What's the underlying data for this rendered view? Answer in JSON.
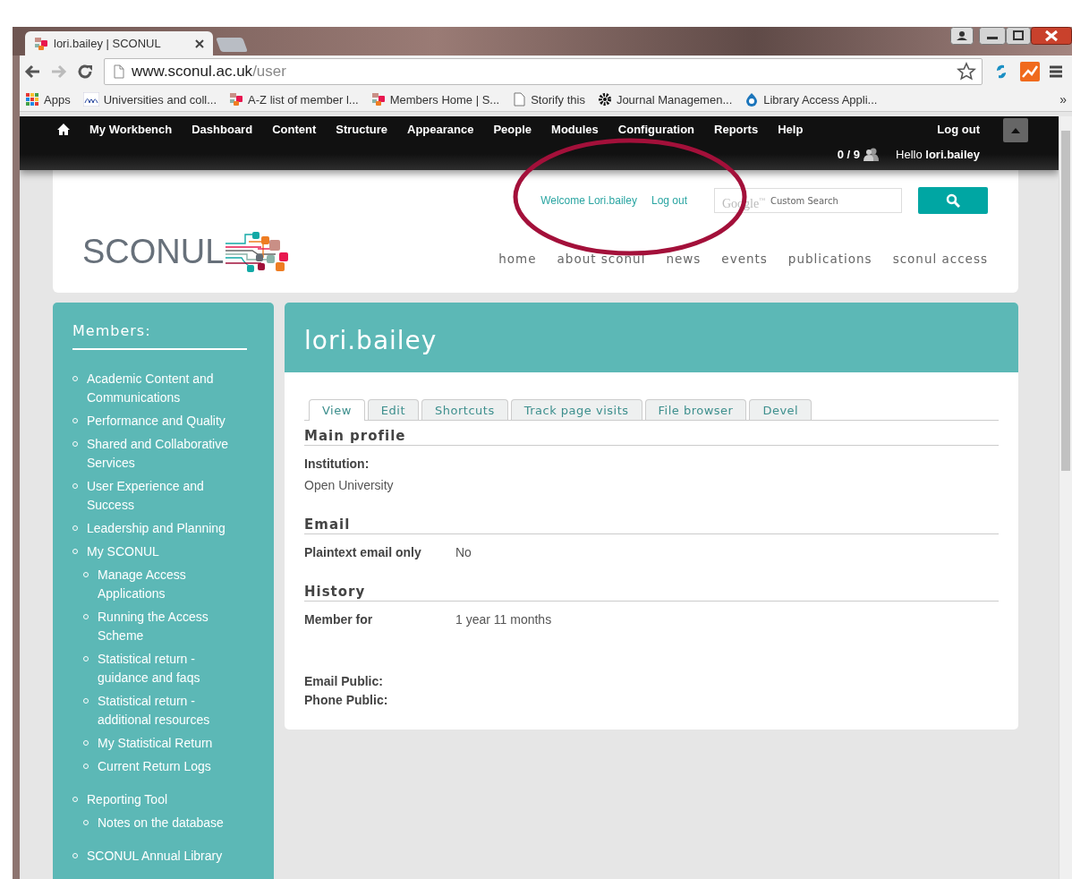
{
  "browser": {
    "tabs": [
      {
        "title": "lori.bailey | SCONUL",
        "kind": "page",
        "selected": true
      },
      {
        "kind": "new",
        "selected": false
      }
    ],
    "url": {
      "host": "www.sconul.ac.uk",
      "path": "/user"
    },
    "bookmarks": [
      {
        "label": "Apps",
        "kind": "apps"
      },
      {
        "label": "Universities and coll...",
        "kind": "hefce"
      },
      {
        "label": "A-Z list of member l...",
        "kind": "sconul"
      },
      {
        "label": "Members Home | S...",
        "kind": "sconul"
      },
      {
        "label": "Storify this",
        "kind": "page"
      },
      {
        "label": "Journal Managemen...",
        "kind": "gear"
      },
      {
        "label": "Library Access Appli...",
        "kind": "drop"
      }
    ],
    "more": "»"
  },
  "admin_bar": {
    "items": [
      "My Workbench",
      "Dashboard",
      "Content",
      "Structure",
      "Appearance",
      "People",
      "Modules",
      "Configuration",
      "Reports",
      "Help"
    ],
    "logout": "Log out",
    "counter": "0 / 9",
    "greeting": "Hello **lori.bailey**"
  },
  "header": {
    "welcome": "Welcome Lori.bailey",
    "logout": "Log out",
    "search": {
      "brand": "Google",
      "brand_mark": "™",
      "placeholder": "Custom Search"
    },
    "logo": "SCONUL",
    "nav": [
      "home",
      "about sconul",
      "news",
      "events",
      "publications",
      "sconul access"
    ]
  },
  "sidebar": {
    "title": "Members:",
    "items": [
      {
        "label": "Academic Content and Communications"
      },
      {
        "label": "Performance and Quality"
      },
      {
        "label": "Shared and Collaborative Services"
      },
      {
        "label": "User Experience and Success"
      },
      {
        "label": "Leadership and Planning"
      },
      {
        "label": "My SCONUL",
        "children": [
          {
            "label": "Manage Access Applications"
          },
          {
            "label": "Running the Access Scheme"
          },
          {
            "label": "Statistical return - guidance and faqs"
          },
          {
            "label": "Statistical return - additional resources"
          },
          {
            "label": "My Statistical Return"
          },
          {
            "label": "Current Return Logs"
          }
        ]
      },
      {
        "label": "Reporting Tool",
        "children": [
          {
            "label": "Notes on the database"
          }
        ]
      },
      {
        "label": "SCONUL Annual Library"
      }
    ]
  },
  "main": {
    "title": "lori.bailey",
    "tabs": [
      {
        "label": "View",
        "selected": true
      },
      {
        "label": "Edit",
        "selected": false
      },
      {
        "label": "Shortcuts",
        "selected": false
      },
      {
        "label": "Track page visits",
        "selected": false
      },
      {
        "label": "File browser",
        "selected": false
      },
      {
        "label": "Devel",
        "selected": false
      }
    ],
    "sections": [
      {
        "heading": "Main profile",
        "fields": [
          {
            "kind": "stacked",
            "label": "Institution:",
            "value": "Open University"
          }
        ]
      },
      {
        "heading": "Email",
        "fields": [
          {
            "kind": "inline",
            "label": "Plaintext email only",
            "value": "No"
          }
        ]
      },
      {
        "heading": "History",
        "fields": [
          {
            "kind": "inline",
            "label": "Member for",
            "value": "1 year 11 months"
          }
        ]
      },
      {
        "fields": [
          {
            "kind": "label",
            "label": "Email Public:"
          },
          {
            "kind": "label",
            "label": "Phone Public:"
          }
        ]
      }
    ]
  },
  "annotations": [
    {
      "kind": "ellipse"
    }
  ]
}
